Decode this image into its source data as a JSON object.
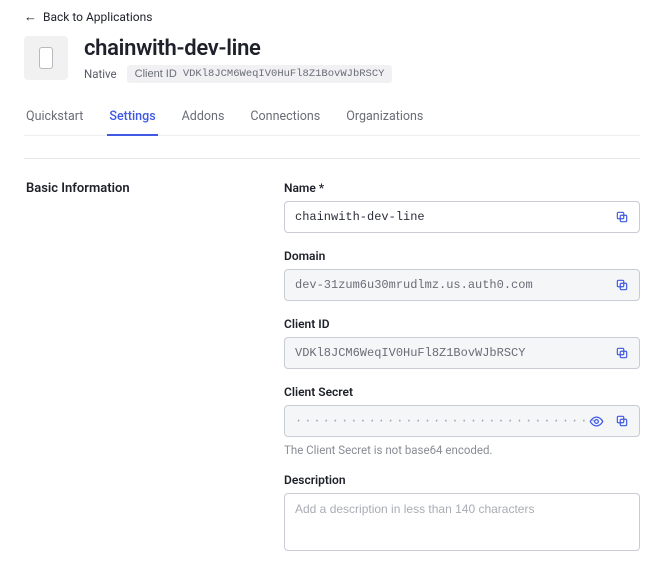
{
  "nav": {
    "back_label": "Back to Applications"
  },
  "header": {
    "app_name": "chainwith-dev-line",
    "app_type": "Native",
    "client_id_label": "Client ID",
    "client_id_value": "VDKl8JCM6WeqIV0HuFl8Z1BovWJbRSCY"
  },
  "tabs": {
    "quickstart": "Quickstart",
    "settings": "Settings",
    "addons": "Addons",
    "connections": "Connections",
    "organizations": "Organizations"
  },
  "section": {
    "title": "Basic Information"
  },
  "fields": {
    "name": {
      "label": "Name *",
      "value": "chainwith-dev-line"
    },
    "domain": {
      "label": "Domain",
      "value": "dev-31zum6u30mrudlmz.us.auth0.com"
    },
    "client_id": {
      "label": "Client ID",
      "value": "VDKl8JCM6WeqIV0HuFl8Z1BovWJbRSCY"
    },
    "client_secret": {
      "label": "Client Secret",
      "masked": "············································",
      "hint": "The Client Secret is not base64 encoded."
    },
    "description": {
      "label": "Description",
      "placeholder": "Add a description in less than 140 characters"
    }
  }
}
